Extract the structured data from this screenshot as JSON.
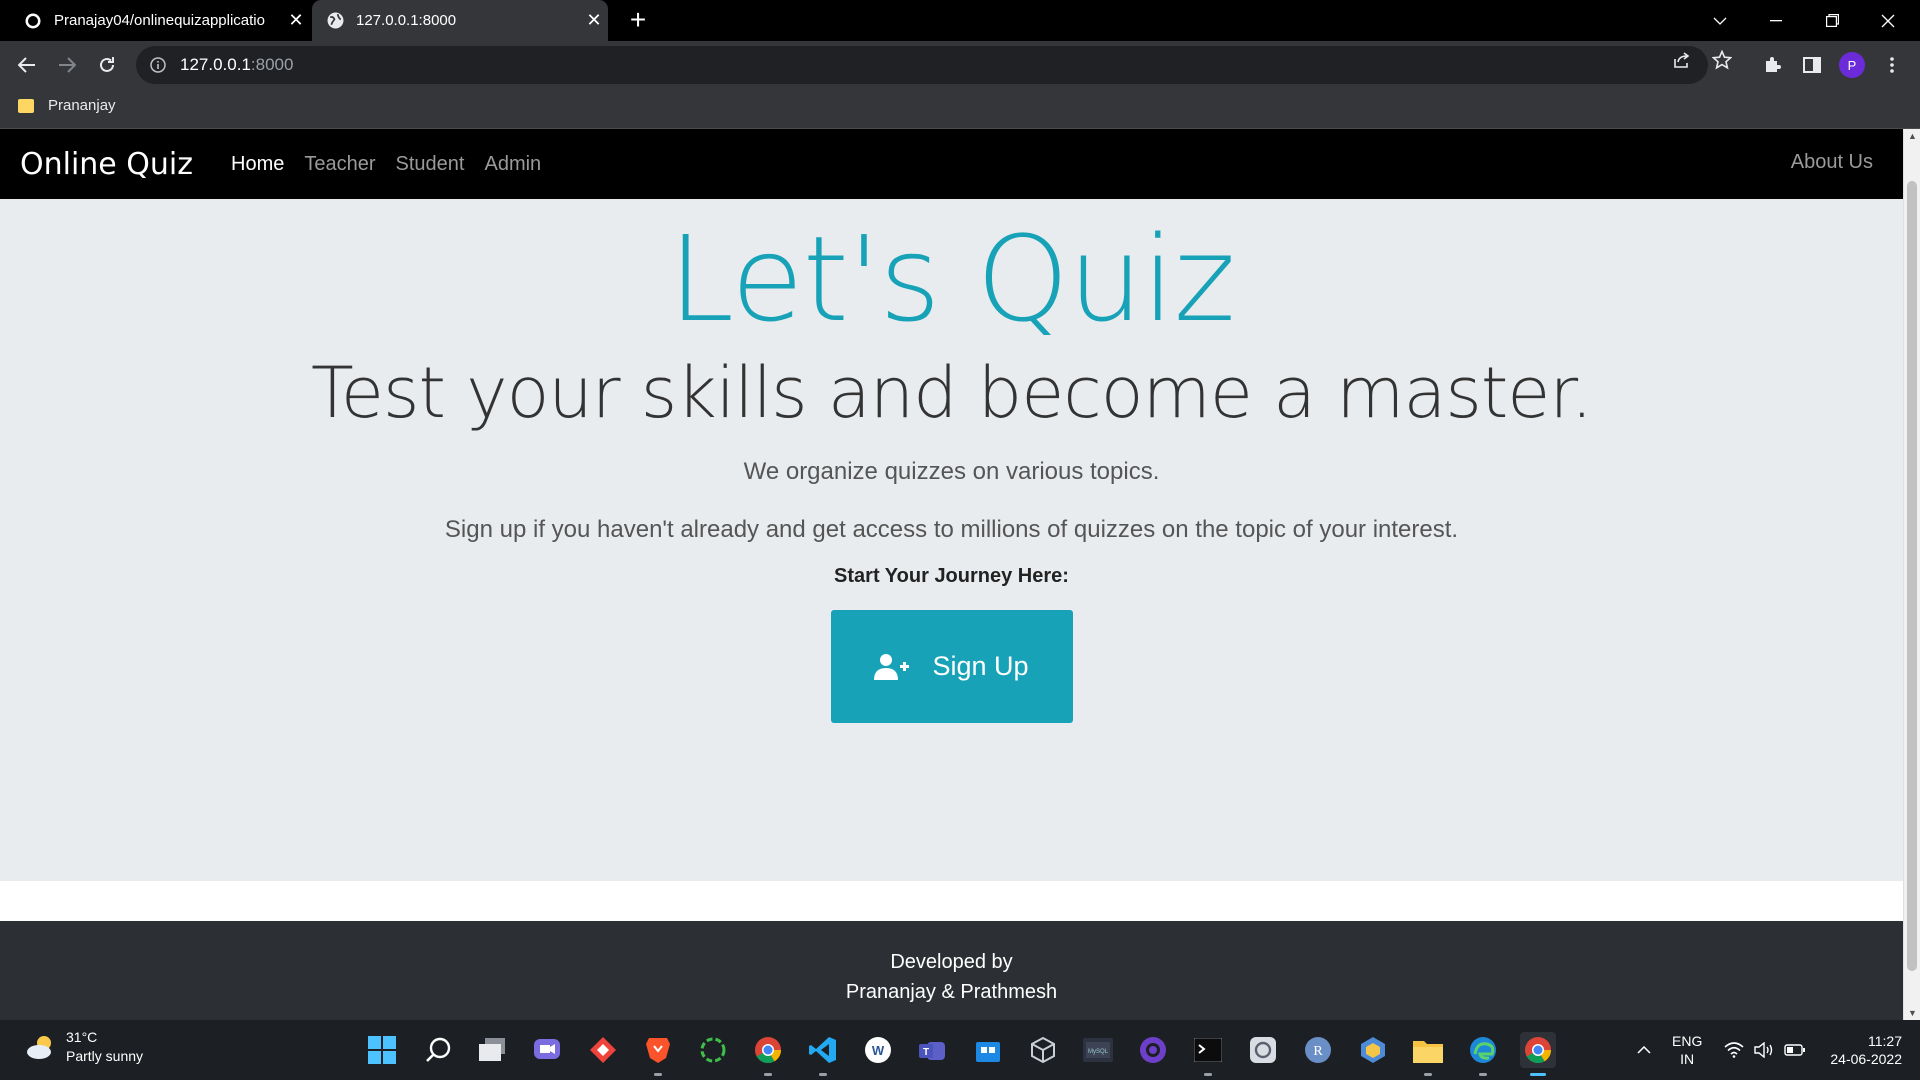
{
  "browser": {
    "tabs": [
      {
        "title": "Pranajay04/onlinequizapplicatio",
        "active": false
      },
      {
        "title": "127.0.0.1:8000",
        "active": true
      }
    ],
    "url_host": "127.0.0.1",
    "url_port": ":8000",
    "bookmark": "Prananjay",
    "profile_initial": "P"
  },
  "navbar": {
    "brand": "Online Quiz",
    "links": [
      "Home",
      "Teacher",
      "Student",
      "Admin"
    ],
    "active_link": "Home",
    "right_link": "About Us"
  },
  "hero": {
    "title": "Let's Quiz",
    "subtitle": "Test your skills and become a master.",
    "lead1": "We organize quizzes on various topics.",
    "lead2": "Sign up if you haven't already and get access to millions of quizzes on the topic of your interest.",
    "start_label": "Start Your Journey Here:",
    "button_label": "Sign Up"
  },
  "footer": {
    "line1": "Developed by",
    "line2": "Prananjay & Prathmesh"
  },
  "taskbar": {
    "weather_temp": "31°C",
    "weather_desc": "Partly sunny",
    "lang_top": "ENG",
    "lang_bottom": "IN",
    "time": "11:27",
    "date": "24-06-2022"
  },
  "colors": {
    "accent": "#17a2b8",
    "navbar_bg": "#000000",
    "hero_bg": "#e9ecef",
    "footer_bg": "#2c3034"
  }
}
